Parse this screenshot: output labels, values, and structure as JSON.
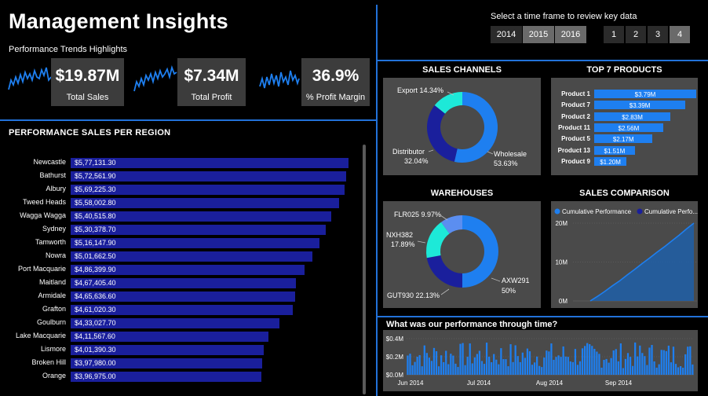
{
  "header": {
    "title": "Management Insights",
    "subtitle": "Performance Trends Highlights"
  },
  "kpis": [
    {
      "value": "$19.87M",
      "label": "Total Sales"
    },
    {
      "value": "$7.34M",
      "label": "Total Profit"
    },
    {
      "value": "36.9%",
      "label": "% Profit Margin"
    }
  ],
  "timeframe": {
    "label": "Select a time frame to review key data",
    "years": [
      {
        "label": "2014",
        "selected": false
      },
      {
        "label": "2015",
        "selected": true
      },
      {
        "label": "2016",
        "selected": true
      }
    ],
    "quarters": [
      {
        "label": "1",
        "selected": false
      },
      {
        "label": "2",
        "selected": false
      },
      {
        "label": "3",
        "selected": false
      },
      {
        "label": "4",
        "selected": true
      }
    ]
  },
  "region_section": {
    "title": "PERFORMANCE SALES PER REGION",
    "rows": [
      {
        "name": "Newcastle",
        "label": "$5,77,131.30",
        "value": 577131.3
      },
      {
        "name": "Bathurst",
        "label": "$5,72,561.90",
        "value": 572561.9
      },
      {
        "name": "Albury",
        "label": "$5,69,225.30",
        "value": 569225.3
      },
      {
        "name": "Tweed Heads",
        "label": "$5,58,002.80",
        "value": 558002.8
      },
      {
        "name": "Wagga Wagga",
        "label": "$5,40,515.80",
        "value": 540515.8
      },
      {
        "name": "Sydney",
        "label": "$5,30,378.70",
        "value": 530378.7
      },
      {
        "name": "Tamworth",
        "label": "$5,16,147.90",
        "value": 516147.9
      },
      {
        "name": "Nowra",
        "label": "$5,01,662.50",
        "value": 501662.5
      },
      {
        "name": "Port Macquarie",
        "label": "$4,86,399.90",
        "value": 486399.9
      },
      {
        "name": "Maitland",
        "label": "$4,67,405.40",
        "value": 467405.4
      },
      {
        "name": "Armidale",
        "label": "$4,65,636.60",
        "value": 465636.6
      },
      {
        "name": "Grafton",
        "label": "$4,61,020.30",
        "value": 461020.3
      },
      {
        "name": "Goulburn",
        "label": "$4,33,027.70",
        "value": 433027.7
      },
      {
        "name": "Lake Macquarie",
        "label": "$4,11,567.60",
        "value": 411567.6
      },
      {
        "name": "Lismore",
        "label": "$4,01,390.30",
        "value": 401390.3
      },
      {
        "name": "Broken Hill",
        "label": "$3,97,980.00",
        "value": 397980.0
      },
      {
        "name": "Orange",
        "label": "$3,96,975.00",
        "value": 396975.0
      }
    ]
  },
  "sales_channels": {
    "title": "SALES CHANNELS",
    "slices": [
      {
        "name": "Wholesale",
        "pct": "53.63%",
        "value": 53.63,
        "color": "#1e7ff0"
      },
      {
        "name": "Distributor",
        "pct": "32.04%",
        "value": 32.04,
        "color": "#1a1f9c"
      },
      {
        "name": "Export",
        "pct": "14.34%",
        "value": 14.34,
        "color": "#1de9d8"
      }
    ]
  },
  "top_products": {
    "title": "TOP 7 PRODUCTS",
    "rows": [
      {
        "name": "Product 1",
        "label": "$3.79M",
        "value": 3.79
      },
      {
        "name": "Product 7",
        "label": "$3.39M",
        "value": 3.39
      },
      {
        "name": "Product 2",
        "label": "$2.83M",
        "value": 2.83
      },
      {
        "name": "Product 11",
        "label": "$2.56M",
        "value": 2.56
      },
      {
        "name": "Product 5",
        "label": "$2.17M",
        "value": 2.17
      },
      {
        "name": "Product 13",
        "label": "$1.51M",
        "value": 1.51
      },
      {
        "name": "Product 9",
        "label": "$1.20M",
        "value": 1.2
      }
    ]
  },
  "warehouses": {
    "title": "WAREHOUSES",
    "slices": [
      {
        "name": "AXW291",
        "pct": "50%",
        "value": 50,
        "color": "#1e7ff0"
      },
      {
        "name": "GUT930",
        "pct": "22.13%",
        "value": 22.13,
        "color": "#1a1f9c"
      },
      {
        "name": "NXH382",
        "pct": "17.89%",
        "value": 17.89,
        "color": "#1de9d8"
      },
      {
        "name": "FLR025",
        "pct": "9.97%",
        "value": 9.97,
        "color": "#5b8ef0"
      }
    ]
  },
  "sales_comparison": {
    "title": "SALES COMPARISON",
    "legend": [
      "Cumulative Performance",
      "Cumulative Perfo..."
    ],
    "yticks": [
      "20M",
      "10M",
      "0M"
    ],
    "colors": {
      "series1": "#1e7ff0",
      "series2": "#1a1f9c"
    }
  },
  "timeline": {
    "title": "What was our performance through time?",
    "yticks": [
      "$0.4M",
      "$0.2M",
      "$0.0M"
    ],
    "xticks": [
      "Jun 2014",
      "Jul 2014",
      "Aug 2014",
      "Sep 2014"
    ]
  },
  "chart_data": [
    {
      "type": "pie",
      "title": "SALES CHANNELS",
      "categories": [
        "Wholesale",
        "Distributor",
        "Export"
      ],
      "values": [
        53.63,
        32.04,
        14.34
      ]
    },
    {
      "type": "bar",
      "title": "TOP 7 PRODUCTS",
      "categories": [
        "Product 1",
        "Product 7",
        "Product 2",
        "Product 11",
        "Product 5",
        "Product 13",
        "Product 9"
      ],
      "values": [
        3.79,
        3.39,
        2.83,
        2.56,
        2.17,
        1.51,
        1.2
      ]
    },
    {
      "type": "pie",
      "title": "WAREHOUSES",
      "categories": [
        "AXW291",
        "GUT930",
        "NXH382",
        "FLR025"
      ],
      "values": [
        50,
        22.13,
        17.89,
        9.97
      ]
    },
    {
      "type": "area",
      "title": "SALES COMPARISON",
      "ylim": [
        0,
        20
      ],
      "series": [
        {
          "name": "Cumulative Performance",
          "values": [
            0,
            1.2,
            2.5,
            3.9,
            5.2,
            6.7,
            8.1,
            9.6,
            11.0,
            12.5,
            13.9,
            15.4,
            16.9,
            18.5,
            20.0
          ]
        }
      ]
    },
    {
      "type": "bar",
      "title": "What was our performance through time?",
      "x": [
        "Jun 2014",
        "Jul 2014",
        "Aug 2014",
        "Sep 2014"
      ],
      "ylim": [
        0,
        0.4
      ]
    }
  ]
}
